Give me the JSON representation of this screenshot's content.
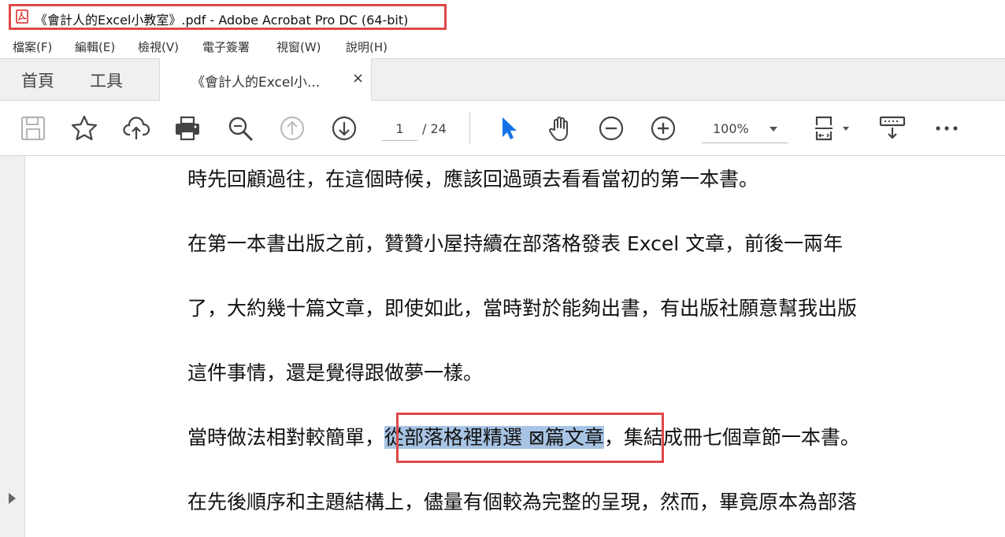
{
  "window": {
    "title": "《會計人的Excel小教室》.pdf - Adobe Acrobat Pro DC (64-bit)",
    "app_icon": "pdf-icon"
  },
  "menu": {
    "items": [
      "檔案(F)",
      "編輯(E)",
      "檢視(V)",
      "電子簽署",
      "視窗(W)",
      "說明(H)"
    ]
  },
  "tabs": {
    "home": "首頁",
    "tools": "工具",
    "document": "《會計人的Excel小...",
    "close": "×"
  },
  "toolbar": {
    "icons": [
      "save-icon",
      "star-icon",
      "cloud-upload-icon",
      "print-icon",
      "zoom-search-icon",
      "page-up-icon",
      "page-down-icon",
      "select-pointer-icon",
      "hand-tool-icon",
      "zoom-out-icon",
      "zoom-in-icon",
      "fit-page-icon",
      "comment-tool-icon",
      "more-icon"
    ],
    "page_current": "1",
    "page_total": "/ 24",
    "zoom": "100%",
    "accent_color": "#1473e6"
  },
  "document": {
    "lines": [
      "時先回顧過往，在這個時候，應該回過頭去看看當初的第一本書。",
      "在第一本書出版之前，贊贊小屋持續在部落格發表 Excel 文章，前後一兩年",
      "了，大約幾十篇文章，即使如此，當時對於能夠出書，有出版社願意幫我出版",
      "這件事情，還是覺得跟做夢一樣。"
    ],
    "highlight_line": {
      "before": "當時做法相對較簡單，",
      "selected": "從部落格裡精選 ⊠篇文章",
      "after": "，集結成冊七個章節一本書。"
    },
    "last_line": "在先後順序和主題結構上，儘量有個較為完整的呈現，然而，畢竟原本為部落"
  }
}
